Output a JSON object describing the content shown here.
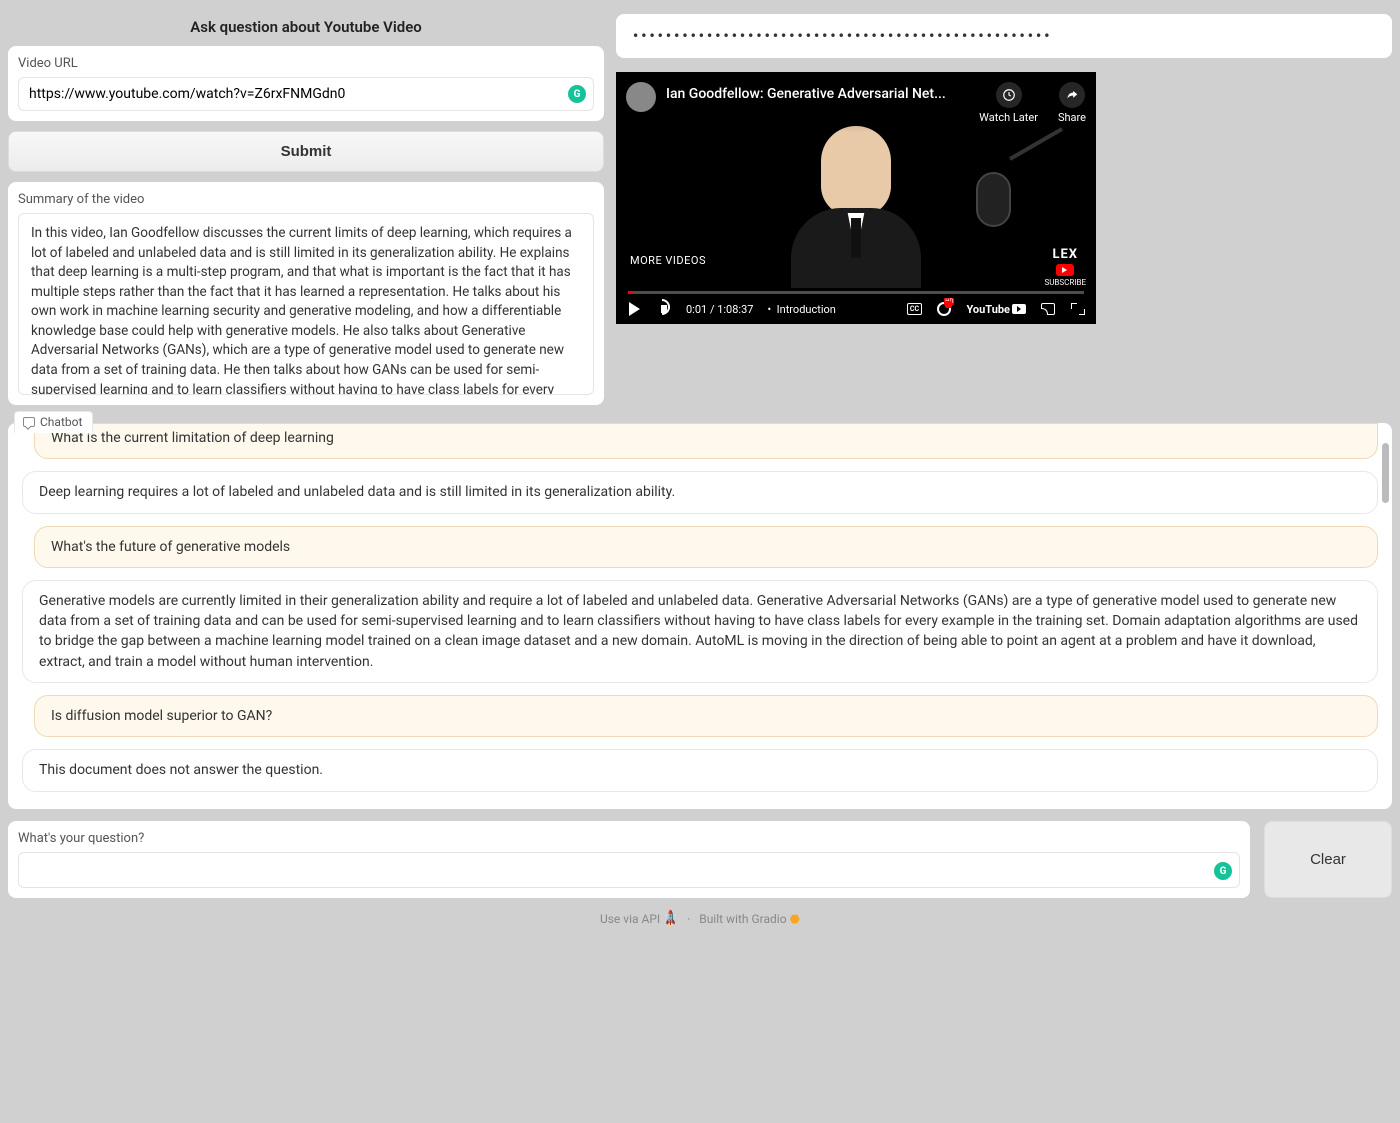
{
  "app": {
    "title": "Ask question about Youtube Video"
  },
  "video_url": {
    "label": "Video URL",
    "value": "https://www.youtube.com/watch?v=Z6rxFNMGdn0"
  },
  "submit_label": "Submit",
  "summary": {
    "label": "Summary of the video",
    "text": "In this video, Ian Goodfellow discusses the current limits of deep learning, which requires a lot of labeled and unlabeled data and is still limited in its generalization ability. He explains that deep learning is a multi-step program, and that what is important is the fact that it has multiple steps rather than the fact that it has learned a representation. He talks about his own work in machine learning security and generative modeling, and how a differentiable knowledge base could help with generative models. He also talks about Generative Adversarial Networks (GANs), which are a type of generative model used to generate new data from a set of training data. He then talks about how GANs can be used for semi-supervised learning and to learn classifiers without having to have class labels for every example in the training set. He also discusses domain adaptation algorithms, which are used to bridge the gap between a machine learning model trained on a clean image dataset and a new domain. Finally, he talks about the need for better definitions and concepts related to fairness and interpretability in machine learning, and suggests that AutoML is moving in the direction of being able to point an agent at a problem and have it download, extract, and train a model without"
  },
  "api_key_masked": "•••••••••••••••••••••••••••••••••••••••••••••••••••",
  "video": {
    "title": "Ian Goodfellow: Generative Adversarial Net...",
    "watch_later": "Watch Later",
    "share": "Share",
    "more_videos": "MORE VIDEOS",
    "channel": "LEX",
    "subscribe": "SUBSCRIBE",
    "time": "0:01 / 1:08:37",
    "chapter_prefix": "•",
    "chapter": "Introduction",
    "cc": "CC",
    "youtube": "YouTube"
  },
  "chatbot": {
    "tab_label": "Chatbot",
    "messages": [
      {
        "role": "user",
        "text": "What is the current limitation of deep learning"
      },
      {
        "role": "bot",
        "text": "Deep learning requires a lot of labeled and unlabeled data and is still limited in its generalization ability."
      },
      {
        "role": "user",
        "text": "What's the future of generative models"
      },
      {
        "role": "bot",
        "text": "Generative models are currently limited in their generalization ability and require a lot of labeled and unlabeled data. Generative Adversarial Networks (GANs) are a type of generative model used to generate new data from a set of training data and can be used for semi-supervised learning and to learn classifiers without having to have class labels for every example in the training set. Domain adaptation algorithms are used to bridge the gap between a machine learning model trained on a clean image dataset and a new domain. AutoML is moving in the direction of being able to point an agent at a problem and have it download, extract, and train a model without human intervention."
      },
      {
        "role": "user",
        "text": "Is diffusion model superior to GAN?"
      },
      {
        "role": "bot",
        "text": "This document does not answer the question."
      }
    ]
  },
  "question": {
    "label": "What's your question?",
    "value": ""
  },
  "clear_label": "Clear",
  "footer": {
    "use_via_api": "Use via API",
    "built_with": "Built with Gradio"
  }
}
